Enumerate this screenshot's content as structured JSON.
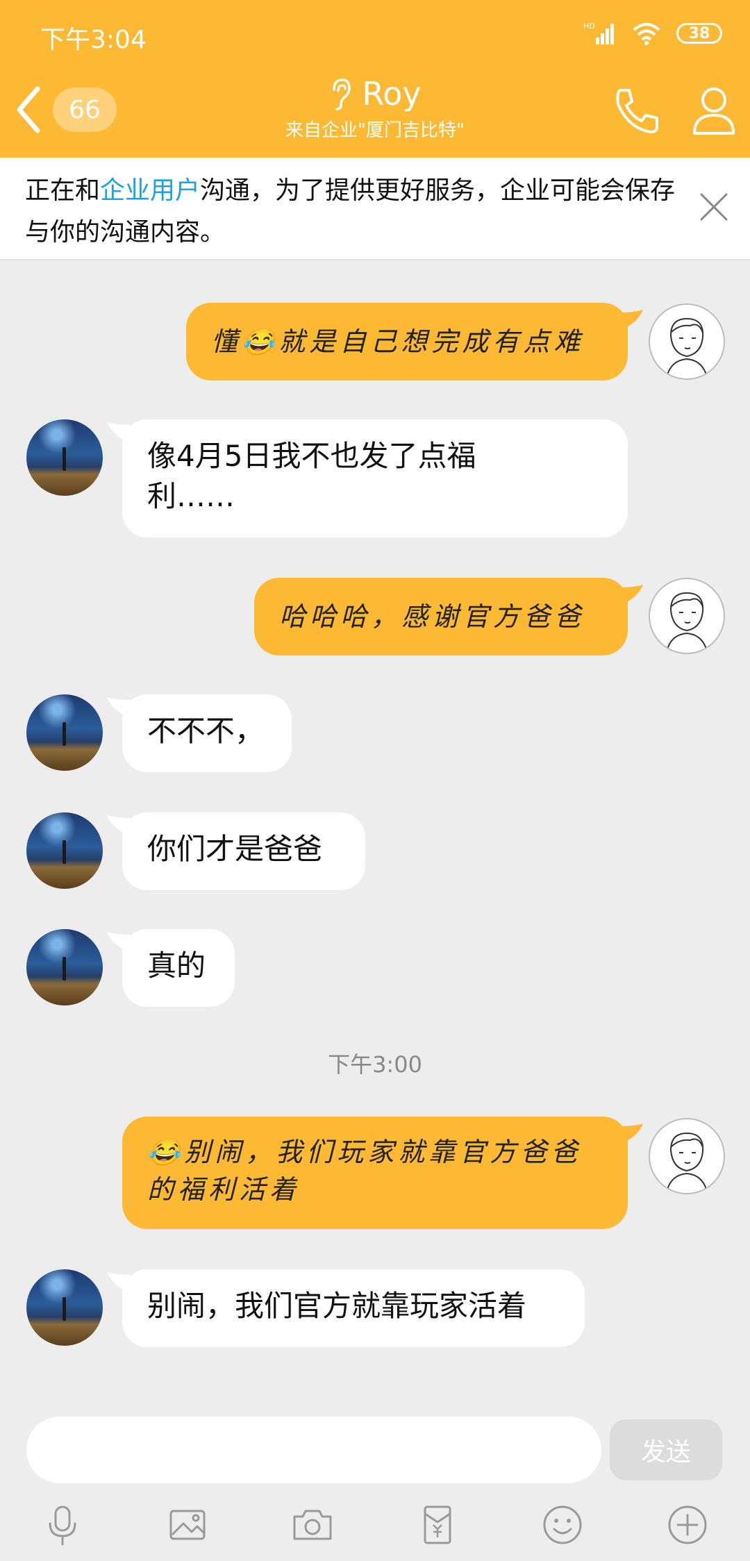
{
  "status_bar": {
    "time": "下午3:04",
    "signal_label": "HD",
    "battery": "38"
  },
  "nav": {
    "unread_count": "66",
    "title": "Roy",
    "subtitle": "来自企业\"厦门吉比特\""
  },
  "notice": {
    "prefix": "正在和",
    "link_text": "企业用户",
    "suffix": "沟通，为了提供更好服务，企业可能会保存与你的沟通内容。"
  },
  "messages": [
    {
      "side": "out",
      "text": "懂😂就是自己想完成有点难"
    },
    {
      "side": "in",
      "text": "像4月5日我不也发了点福利……"
    },
    {
      "side": "out",
      "text": "哈哈哈，感谢官方爸爸"
    },
    {
      "side": "in",
      "text": "不不不，"
    },
    {
      "side": "in",
      "text": "你们才是爸爸"
    },
    {
      "side": "in",
      "text": "真的"
    },
    {
      "side": "out",
      "text": "😂别闹，我们玩家就靠官方爸爸的福利活着"
    },
    {
      "side": "in",
      "text": "别闹，我们官方就靠玩家活着"
    }
  ],
  "timestamp": "下午3:00",
  "composer": {
    "placeholder": "",
    "send_label": "发送"
  },
  "toolbar_icons": [
    "microphone-icon",
    "image-icon",
    "camera-icon",
    "red-packet-icon",
    "emoji-icon",
    "plus-icon"
  ],
  "colors": {
    "accent": "#fdb933",
    "link": "#1aa1e6",
    "background": "#ededed"
  }
}
